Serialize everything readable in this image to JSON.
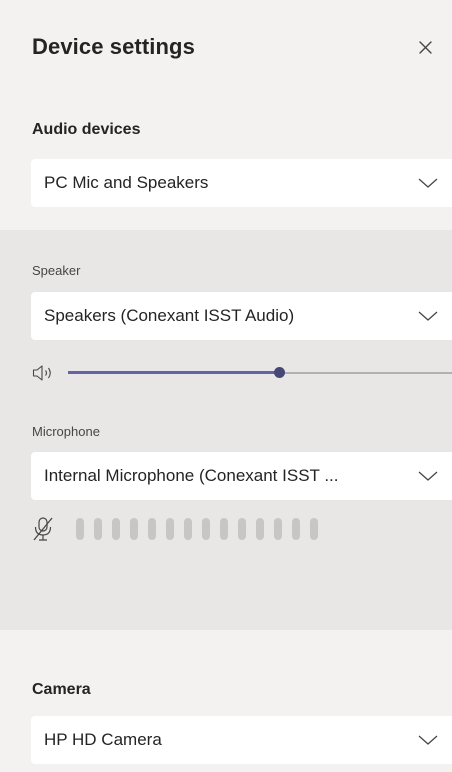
{
  "header": {
    "title": "Device settings",
    "close_icon": "close-icon"
  },
  "audio_devices": {
    "heading": "Audio devices",
    "selected": "PC Mic and Speakers"
  },
  "speaker": {
    "label": "Speaker",
    "selected": "Speakers (Conexant ISST Audio)",
    "volume_icon": "speaker-volume-icon",
    "volume_fraction": 0.55
  },
  "microphone": {
    "label": "Microphone",
    "selected": "Internal Microphone (Conexant ISST ...",
    "mute_icon": "microphone-off-icon",
    "level_bar_count": 14,
    "level_active": 0
  },
  "camera": {
    "heading": "Camera",
    "selected": "HP HD Camera"
  },
  "colors": {
    "panel_background": "#f3f2f1",
    "advanced_background": "#e8e7e6",
    "slider_fill": "#6264a7",
    "slider_thumb": "#464775",
    "level_bar": "#c8c6c4"
  }
}
